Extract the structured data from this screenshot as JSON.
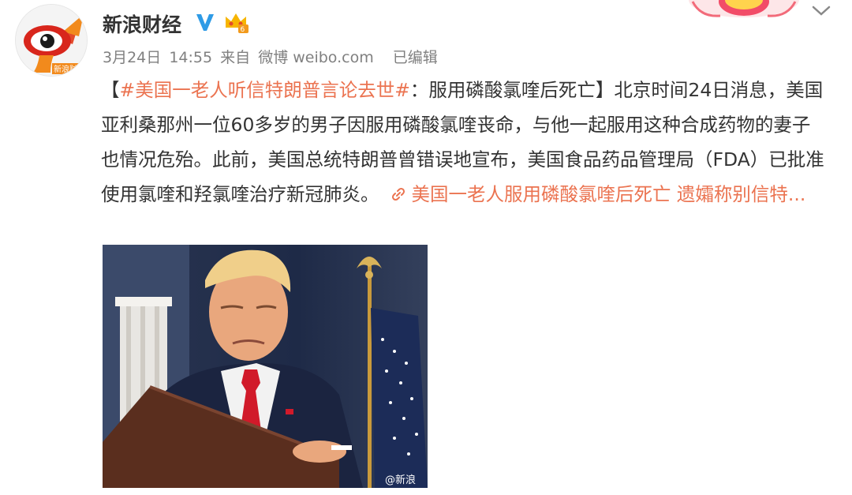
{
  "user": {
    "name": "新浪财经",
    "avatar_text": "新浪财",
    "verified_icon": "verified-v-icon",
    "member_icon": "crown-icon"
  },
  "meta": {
    "date": "3月24日",
    "time": "14:55",
    "source_prefix": "来自",
    "source": "微博 weibo.com",
    "edited": "已编辑"
  },
  "post": {
    "bracket_open": "【",
    "hashtag": "#美国一老人听信特朗普言论去世#",
    "headline_rest": "：服用磷酸氯喹后死亡",
    "bracket_close": "】",
    "body": "北京时间24日消息，美国亚利桑那州一位60多岁的男子因服用磷酸氯喹丧命，与他一起服用这种合成药物的妻子也情况危殆。此前，美国总统特朗普曾错误地宣布，美国食品药品管理局（FDA）已批准使用氯喹和羟氯喹治疗新冠肺炎。",
    "link_icon": "link-icon",
    "link_text": "美国一老人服用磷酸氯喹后死亡 遗孀称别信特..."
  },
  "photo": {
    "watermark": "@新浪"
  },
  "colors": {
    "accent": "#eb7350",
    "meta_gray": "#808080",
    "verified_blue": "#2e9be6",
    "crown_gold": "#f7b500"
  }
}
